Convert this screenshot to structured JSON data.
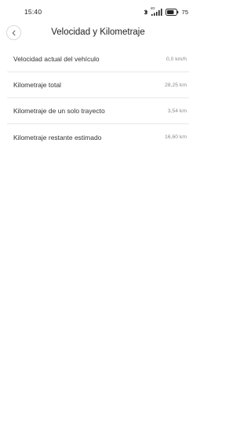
{
  "status_bar": {
    "time": "15:40",
    "network": "4G",
    "battery": "75"
  },
  "header": {
    "title": "Velocidad y Kilometraje",
    "back_icon": "chevron-left-icon"
  },
  "rows": [
    {
      "label": "Velocidad actual del vehículo",
      "value": "0,0 km/h"
    },
    {
      "label": "Kilometraje total",
      "value": "28,25 km"
    },
    {
      "label": "Kilometraje de un solo trayecto",
      "value": "3,54 km"
    },
    {
      "label": "Kilometraje restante estimado",
      "value": "16,60 km"
    }
  ]
}
